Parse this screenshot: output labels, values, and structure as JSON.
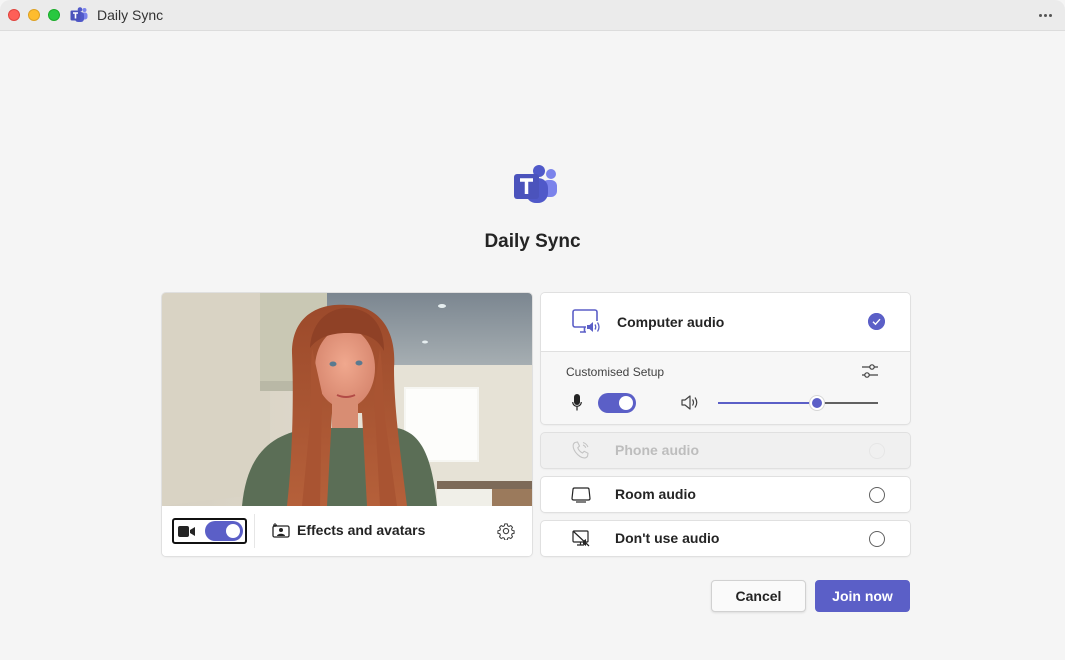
{
  "window": {
    "title": "Daily Sync",
    "more_icon": "more-horizontal-icon",
    "app_icon": "teams-icon"
  },
  "header": {
    "logo": "teams-logo-icon",
    "meeting_title": "Daily Sync"
  },
  "video": {
    "camera_on": true,
    "effects_label": "Effects and avatars",
    "icons": [
      "camera-icon",
      "effects-icon",
      "gear-icon"
    ]
  },
  "audio": {
    "options": [
      {
        "label": "Computer audio",
        "icon": "computer-speaker-icon",
        "selected": true,
        "disabled": false
      },
      {
        "label": "Phone audio",
        "icon": "phone-icon",
        "selected": false,
        "disabled": true
      },
      {
        "label": "Room audio",
        "icon": "room-device-icon",
        "selected": false,
        "disabled": false
      },
      {
        "label": "Don't use audio",
        "icon": "no-audio-icon",
        "selected": false,
        "disabled": false
      }
    ],
    "custom_setup_label": "Customised Setup",
    "mic_on": true,
    "volume_percent": 62
  },
  "actions": {
    "cancel_label": "Cancel",
    "join_label": "Join now"
  },
  "colors": {
    "accent": "#5b5fc7",
    "background": "#f5f5f5",
    "titlebar": "#ebebeb"
  }
}
